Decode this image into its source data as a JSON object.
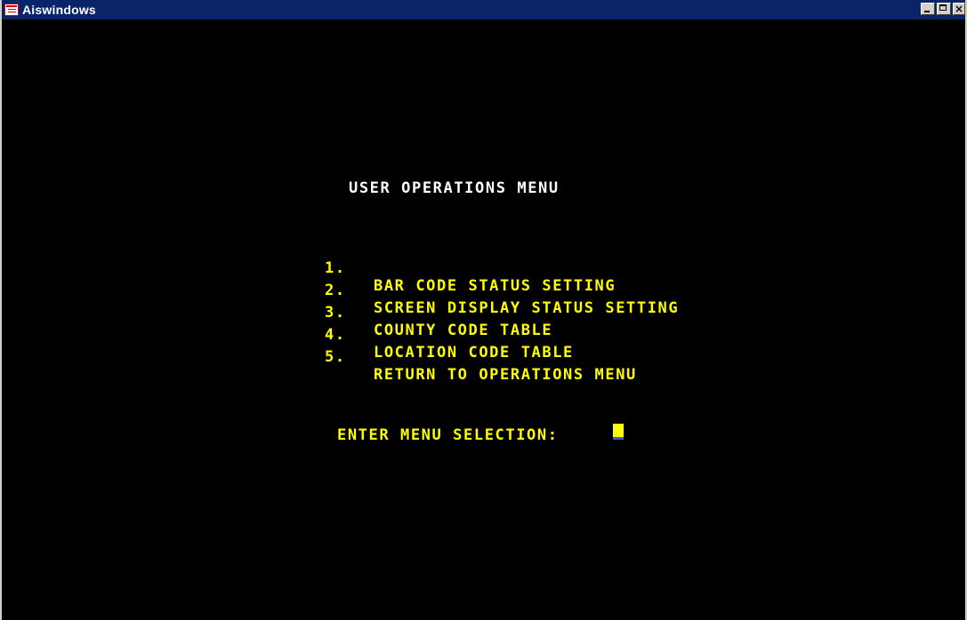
{
  "window": {
    "title": "Aiswindows",
    "close_glyph": "×"
  },
  "screen": {
    "heading": "USER OPERATIONS MENU",
    "menu": [
      {
        "number": "1.",
        "label": "BAR CODE STATUS SETTING"
      },
      {
        "number": "2.",
        "label": "SCREEN DISPLAY STATUS SETTING"
      },
      {
        "number": "3.",
        "label": "COUNTY CODE TABLE"
      },
      {
        "number": "4.",
        "label": "LOCATION CODE TABLE"
      },
      {
        "number": "5.",
        "label": "RETURN TO OPERATIONS MENU"
      }
    ],
    "prompt": "ENTER MENU SELECTION:",
    "selection_value": ""
  },
  "colors": {
    "title_bar": "#0a246a",
    "terminal_background": "#000000",
    "heading_text": "#ffffff",
    "menu_text": "#ffff00",
    "cursor": "#ffff00"
  },
  "icons": {
    "app": "window-app-icon",
    "minimize": "minimize-icon",
    "maximize": "maximize-icon",
    "close": "close-icon"
  }
}
